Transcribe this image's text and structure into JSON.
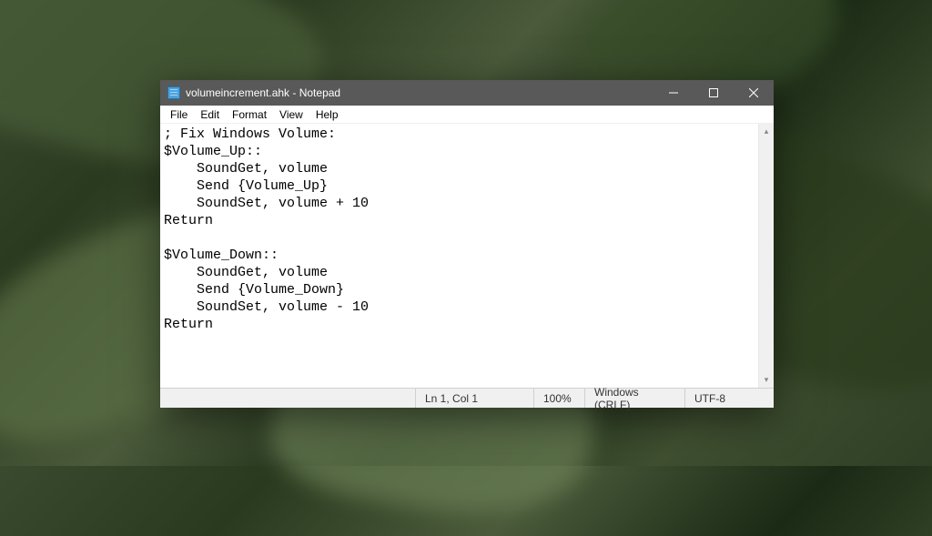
{
  "window": {
    "title": "volumeincrement.ahk - Notepad"
  },
  "menu": {
    "file": "File",
    "edit": "Edit",
    "format": "Format",
    "view": "View",
    "help": "Help"
  },
  "editor": {
    "content": "; Fix Windows Volume:\n$Volume_Up::\n    SoundGet, volume\n    Send {Volume_Up}\n    SoundSet, volume + 10\nReturn\n\n$Volume_Down::\n    SoundGet, volume\n    Send {Volume_Down}\n    SoundSet, volume - 10\nReturn"
  },
  "status": {
    "position": "Ln 1, Col 1",
    "zoom": "100%",
    "line_ending": "Windows (CRLF)",
    "encoding": "UTF-8"
  }
}
